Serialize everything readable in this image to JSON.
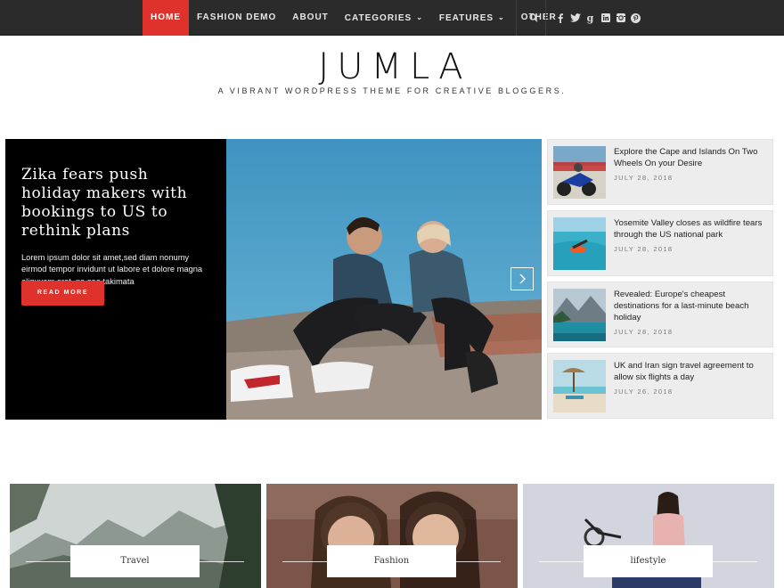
{
  "nav": {
    "items": [
      {
        "label": "Home",
        "active": true
      },
      {
        "label": "Fashion Demo"
      },
      {
        "label": "About"
      },
      {
        "label": "Categories",
        "dropdown": true
      },
      {
        "label": "Features",
        "dropdown": true
      },
      {
        "label": "Other"
      }
    ],
    "search_icon": "search-icon",
    "social": [
      {
        "icon": "facebook-icon",
        "glyph": "f"
      },
      {
        "icon": "twitter-icon",
        "glyph": "t"
      },
      {
        "icon": "google-plus-icon",
        "glyph": "g"
      },
      {
        "icon": "linkedin-icon",
        "glyph": "in"
      },
      {
        "icon": "instagram-icon",
        "glyph": "ig"
      },
      {
        "icon": "pinterest-icon",
        "glyph": "p"
      }
    ],
    "accent": "#e0322d"
  },
  "site": {
    "title": "JUMLA",
    "tagline": "A VIBRANT WORDPRESS THEME FOR CREATIVE BLOGGERS."
  },
  "hero": {
    "title": "Zika fears push holiday makers with bookings to US to rethink plans",
    "excerpt": "Lorem ipsum dolor sit amet,sed diam nonumy eirmod tempor invidunt ut labore et dolore magna aliquyam erat, no sea takimata",
    "button": "Read More"
  },
  "side_posts": [
    {
      "title": "Explore the Cape and Islands On Two Wheels On your Desire",
      "date": "July 28, 2018"
    },
    {
      "title": "Yosemite Valley closes as wildfire tears through the US national park",
      "date": "July 28, 2018"
    },
    {
      "title": "Revealed: Europe's cheapest destinations for a last-minute beach holiday",
      "date": "July 28, 2018"
    },
    {
      "title": "UK and Iran sign travel agreement to allow six flights a day",
      "date": "July 26, 2018"
    }
  ],
  "categories": [
    {
      "label": "Travel"
    },
    {
      "label": "Fashion"
    },
    {
      "label": "lifestyle"
    }
  ]
}
